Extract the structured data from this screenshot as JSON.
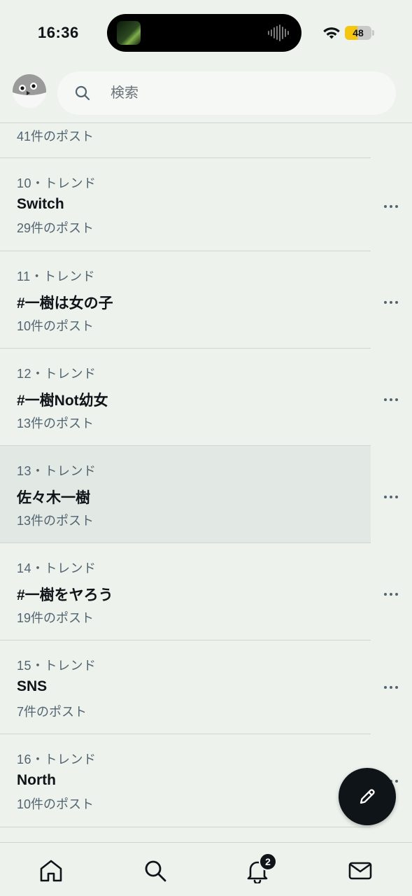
{
  "status_bar": {
    "time": "16:36",
    "battery_level": "48",
    "battery_fraction": 0.48
  },
  "header": {
    "search_placeholder": "検索",
    "avatar_icon": "bird-avatar-icon",
    "search_icon": "search-icon"
  },
  "trends": {
    "partial_top_posts": "41件のポスト",
    "items": [
      {
        "meta": "10・トレンド",
        "name": "Switch",
        "posts": "29件のポスト",
        "highlight": false
      },
      {
        "meta": "11・トレンド",
        "name": "#一樹は女の子",
        "posts": "10件のポスト",
        "highlight": false
      },
      {
        "meta": "12・トレンド",
        "name": "#一樹Not幼女",
        "posts": "13件のポスト",
        "highlight": false
      },
      {
        "meta": "13・トレンド",
        "name": "佐々木一樹",
        "posts": "13件のポスト",
        "highlight": true
      },
      {
        "meta": "14・トレンド",
        "name": "#一樹をヤろう",
        "posts": "19件のポスト",
        "highlight": false
      },
      {
        "meta": "15・トレンド",
        "name": "SNS",
        "posts": "7件のポスト",
        "highlight": false
      },
      {
        "meta": "16・トレンド",
        "name": "North",
        "posts": "10件のポスト",
        "highlight": false
      }
    ]
  },
  "fab": {
    "icon": "compose-pencil-icon"
  },
  "bottom_nav": {
    "items": [
      "home-icon",
      "search-icon",
      "bell-icon",
      "mail-icon"
    ],
    "notification_count": "2"
  },
  "colors": {
    "background": "#edf2ed",
    "text_primary": "#0f1419",
    "text_secondary": "#536471",
    "divider": "#cfd6cf",
    "highlight_row": "#e2e8e3",
    "battery_accent": "#f4c60e"
  }
}
